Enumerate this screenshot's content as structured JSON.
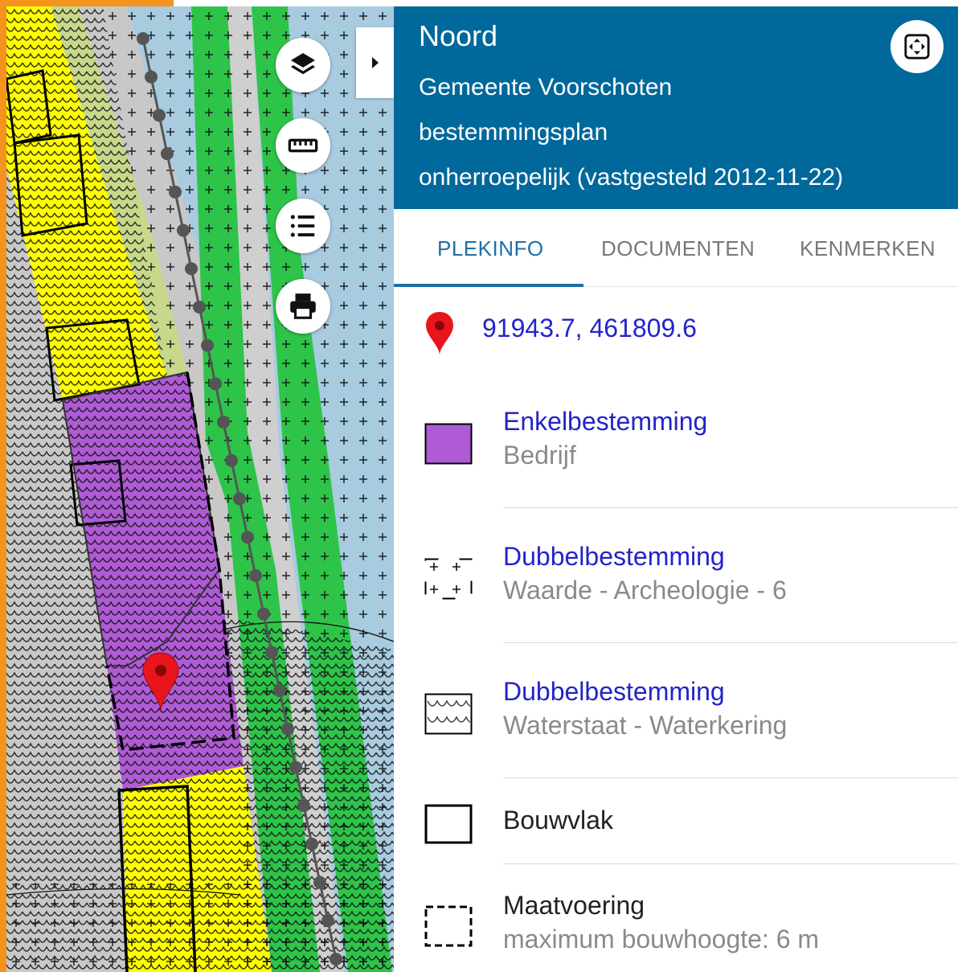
{
  "plan": {
    "name": "Noord",
    "municipality": "Gemeente Voorschoten",
    "type": "bestemmingsplan",
    "status": "onherroepelijk (vastgesteld 2012-11-22)"
  },
  "tabs": [
    {
      "label": "PLEKINFO",
      "active": true
    },
    {
      "label": "DOCUMENTEN",
      "active": false
    },
    {
      "label": "KENMERKEN",
      "active": false
    }
  ],
  "location": {
    "coordinates": "91943.7, 461809.6"
  },
  "entries": [
    {
      "title": "Enkelbestemming",
      "subtitle": "Bedrijf",
      "symbol": "purple-fill-icon",
      "color": "#b05bd6"
    },
    {
      "title": "Dubbelbestemming",
      "subtitle": "Waarde - Archeologie - 6",
      "symbol": "cross-pattern-icon"
    },
    {
      "title": "Dubbelbestemming",
      "subtitle": "Waterstaat - Waterkering",
      "symbol": "wave-pattern-icon"
    },
    {
      "title": "Bouwvlak",
      "subtitle": "",
      "symbol": "solid-outline-icon"
    },
    {
      "title": "Maatvoering",
      "subtitle": "maximum bouwhoogte: 6 m",
      "symbol": "dashed-outline-icon"
    }
  ],
  "map_controls": [
    "layers-icon",
    "ruler-icon",
    "legend-list-icon",
    "print-icon",
    "collapse-arrow-icon",
    "expand-icon"
  ],
  "colors": {
    "header": "#01689b",
    "link": "#2323cc",
    "tab_active": "#1e6fa8",
    "frame": "#f4931e",
    "bedrijf": "#b05bd6",
    "yellow_zone": "#ffff00",
    "green_zone": "#2ec44a",
    "water": "#a8cbe0",
    "olive_zone": "#c7d88a",
    "grey_zone": "#c8c8c8"
  }
}
